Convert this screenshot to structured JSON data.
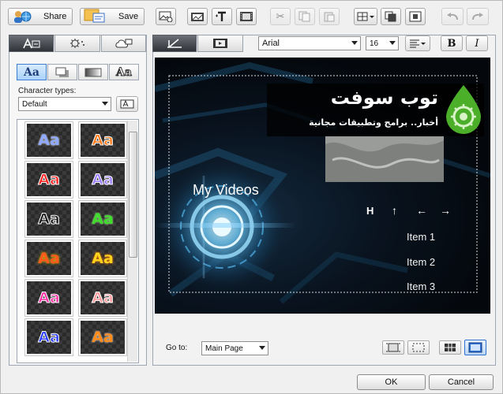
{
  "toolbar": {
    "share_label": "Share",
    "save_label": "Save"
  },
  "left_panel": {
    "tabs": [
      {
        "icon": "text-tab-icon"
      },
      {
        "icon": "effects-tab-icon"
      },
      {
        "icon": "shape-tab-icon"
      }
    ],
    "style_buttons": [
      {
        "label": "Aa",
        "selected": true
      },
      {
        "label": "",
        "selected": false
      },
      {
        "label": "",
        "selected": false
      },
      {
        "label": "Aa",
        "selected": false
      }
    ],
    "character_types_label": "Character types:",
    "character_type_value": "Default",
    "styles": [
      {
        "label": "Aa",
        "color": "#8ea9ff"
      },
      {
        "label": "Aa",
        "color": "#ff7a1a"
      },
      {
        "label": "Aa",
        "color": "#ff2424"
      },
      {
        "label": "Aa",
        "color": "#9b7cff"
      },
      {
        "label": "Aa",
        "color": "#1a1a1a"
      },
      {
        "label": "Aa",
        "color": "#3fdc2b"
      },
      {
        "label": "Aa",
        "color": "#ff5a1e"
      },
      {
        "label": "Aa",
        "color": "#ffd21e"
      },
      {
        "label": "Aa",
        "color": "#ff2fa8"
      },
      {
        "label": "Aa",
        "color": "#ff9a9a"
      },
      {
        "label": "Aa",
        "color": "#2a3cff"
      },
      {
        "label": "Aa",
        "color": "#ff8c1a"
      }
    ]
  },
  "editor": {
    "font_name": "Arial",
    "font_size": "16",
    "bold_label": "B",
    "italic_label": "I"
  },
  "preview": {
    "title": "My Videos",
    "nav_buttons": [
      "H",
      "↑",
      "←",
      "→"
    ],
    "menu_items": [
      "Item 1",
      "Item 2",
      "Item 3"
    ],
    "watermark_title": "توب سوفت",
    "watermark_subtitle": "أخبار.. برامج وتطبيقات مجانية"
  },
  "bottom_bar": {
    "goto_label": "Go to:",
    "goto_value": "Main Page"
  },
  "dialog": {
    "ok_label": "OK",
    "cancel_label": "Cancel"
  },
  "colors": {
    "selected_tab": "#3a3e44",
    "accent_blue": "#2f6fd0",
    "watermark_green": "#4caf2a"
  }
}
